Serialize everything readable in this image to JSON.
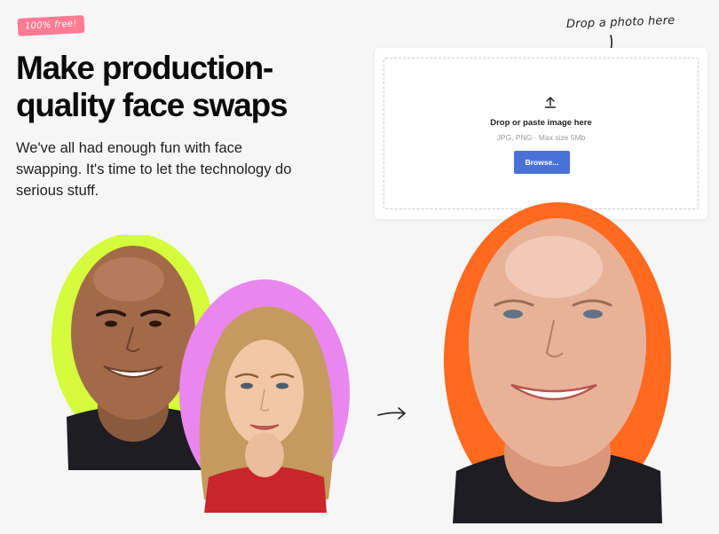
{
  "hero": {
    "badge": "100% free!",
    "title": "Make production-quality face swaps",
    "subtitle": "We've all had enough fun with face swapping. It's time to let the technology do serious stuff."
  },
  "upload": {
    "hint": "Drop a photo here",
    "label": "Drop or paste image here",
    "note": "JPG, PNG · Max size 5Mb",
    "browse": "Browse..."
  },
  "colors": {
    "badge": "#ff7a93",
    "accent": "#4a72d6",
    "lime": "#d4fb3c",
    "violet": "#ea86f0",
    "orange": "#ff6a1f"
  }
}
